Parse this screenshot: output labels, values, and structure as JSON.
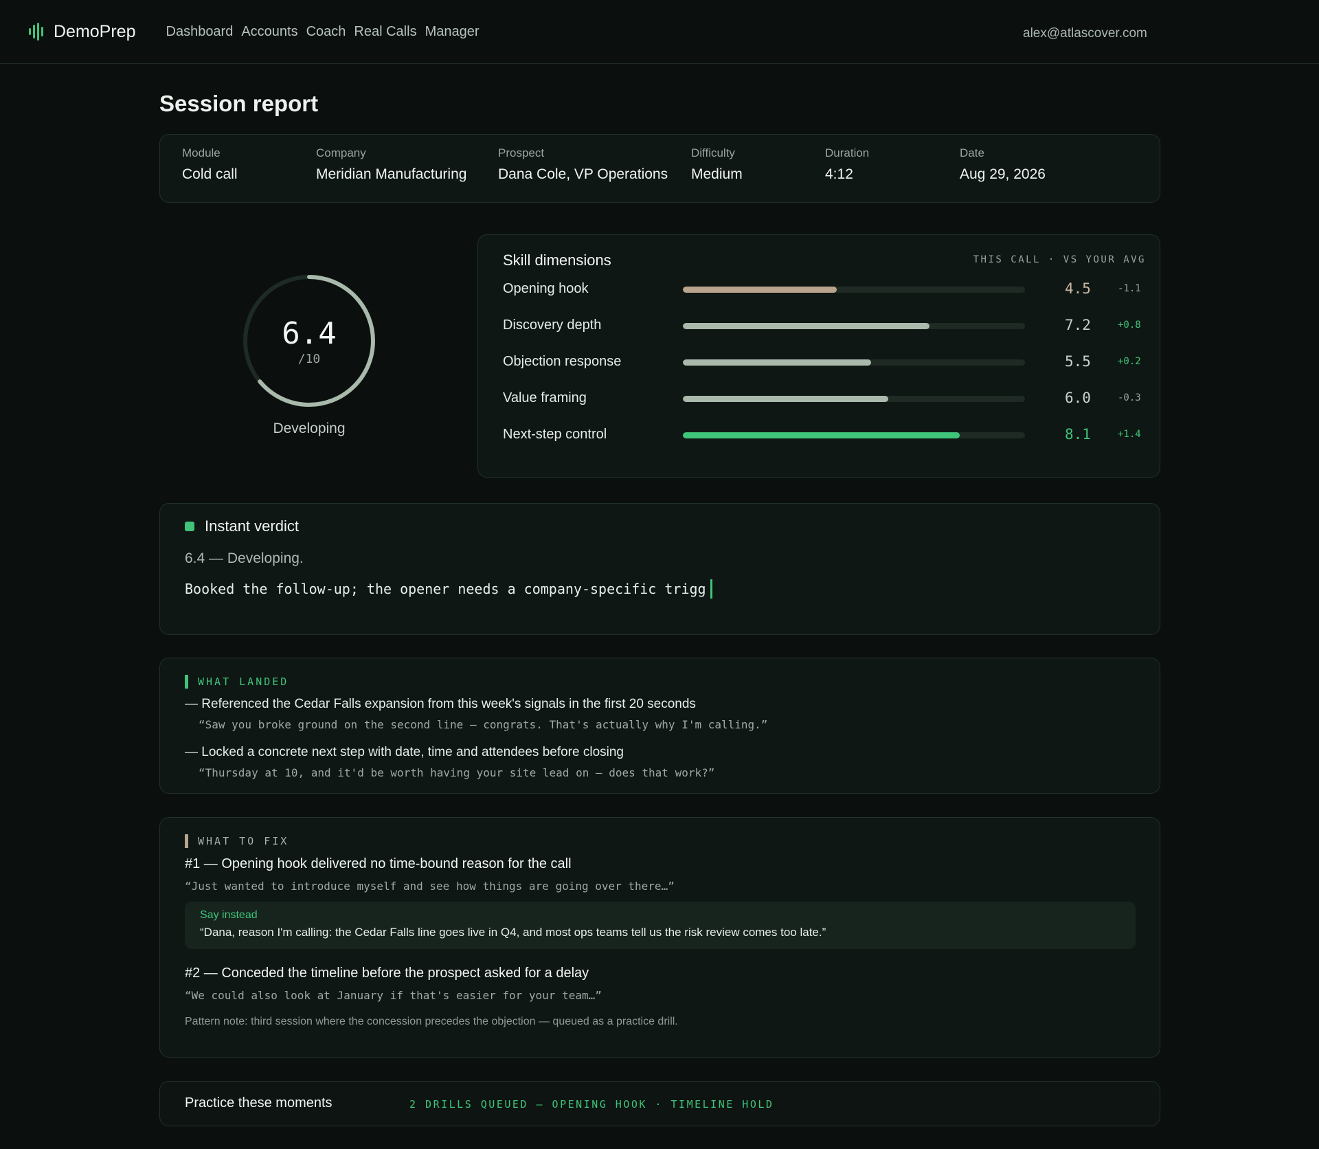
{
  "app": {
    "brand": "DemoPrep",
    "nav": [
      "Dashboard",
      "Accounts",
      "Coach",
      "Real Calls",
      "Manager"
    ],
    "user_email": "alex@atlascover.com"
  },
  "page_title": "Session report",
  "meta": [
    {
      "label": "Module",
      "value": "Cold call"
    },
    {
      "label": "Company",
      "value": "Meridian Manufacturing"
    },
    {
      "label": "Prospect",
      "value": "Dana Cole, VP Operations"
    },
    {
      "label": "Difficulty",
      "value": "Medium"
    },
    {
      "label": "Duration",
      "value": "4:12"
    },
    {
      "label": "Date",
      "value": "Aug 29, 2026"
    }
  ],
  "score": {
    "value": "6.4",
    "out_of": "/10",
    "fraction": 0.64,
    "level": "Developing"
  },
  "skills": {
    "title": "Skill dimensions",
    "legend": "THIS CALL · VS YOUR AVG",
    "rows": [
      {
        "name": "Opening hook",
        "score": "4.5",
        "delta": "-1.1",
        "fraction": 0.45,
        "color": "#b9a48e",
        "score_color": "#c9b7a3",
        "delta_color": "#9aa59f"
      },
      {
        "name": "Discovery depth",
        "score": "7.2",
        "delta": "+0.8",
        "fraction": 0.72,
        "color": "#a9b9ac",
        "score_color": "#c8d2cc",
        "delta_color": "#3fc47a"
      },
      {
        "name": "Objection response",
        "score": "5.5",
        "delta": "+0.2",
        "fraction": 0.55,
        "color": "#a9b9ac",
        "score_color": "#c8d2cc",
        "delta_color": "#3fc47a"
      },
      {
        "name": "Value framing",
        "score": "6.0",
        "delta": "-0.3",
        "fraction": 0.6,
        "color": "#a9b9ac",
        "score_color": "#c8d2cc",
        "delta_color": "#9aa59f"
      },
      {
        "name": "Next-step control",
        "score": "8.1",
        "delta": "+1.4",
        "fraction": 0.81,
        "color": "#3fc47a",
        "score_color": "#3fc47a",
        "delta_color": "#3fc47a"
      }
    ]
  },
  "verdict": {
    "title": "Instant verdict",
    "summary": "6.4 — Developing.",
    "typed": "Booked the follow-up; the opener needs a company-specific trigg"
  },
  "landed": {
    "label": "WHAT LANDED",
    "items": [
      {
        "text": "— Referenced the Cedar Falls expansion from this week's signals in the first 20 seconds",
        "quote": "“Saw you broke ground on the second line — congrats. That's actually why I'm calling.”"
      },
      {
        "text": "— Locked a concrete next step with date, time and attendees before closing",
        "quote": "“Thursday at 10, and it'd be worth having your site lead on — does that work?”"
      }
    ]
  },
  "fix": {
    "label": "WHAT TO FIX",
    "items": [
      {
        "title": "#1 — Opening hook delivered no time-bound reason for the call",
        "quote": "“Just wanted to introduce myself and see how things are going over there…”"
      },
      {
        "title": "#2 — Conceded the timeline before the prospect asked for a delay",
        "quote": "“We could also look at January if that's easier for your team…”"
      }
    ],
    "say_instead_label": "Say instead",
    "say_instead": "“Dana, reason I'm calling: the Cedar Falls line goes live in Q4, and most ops teams tell us the risk review comes too late.”",
    "note": "Pattern note: third session where the concession precedes the objection — queued as a practice drill."
  },
  "practice": {
    "title": "Practice these moments",
    "status": "2 DRILLS QUEUED — OPENING HOOK · TIMELINE HOLD"
  }
}
